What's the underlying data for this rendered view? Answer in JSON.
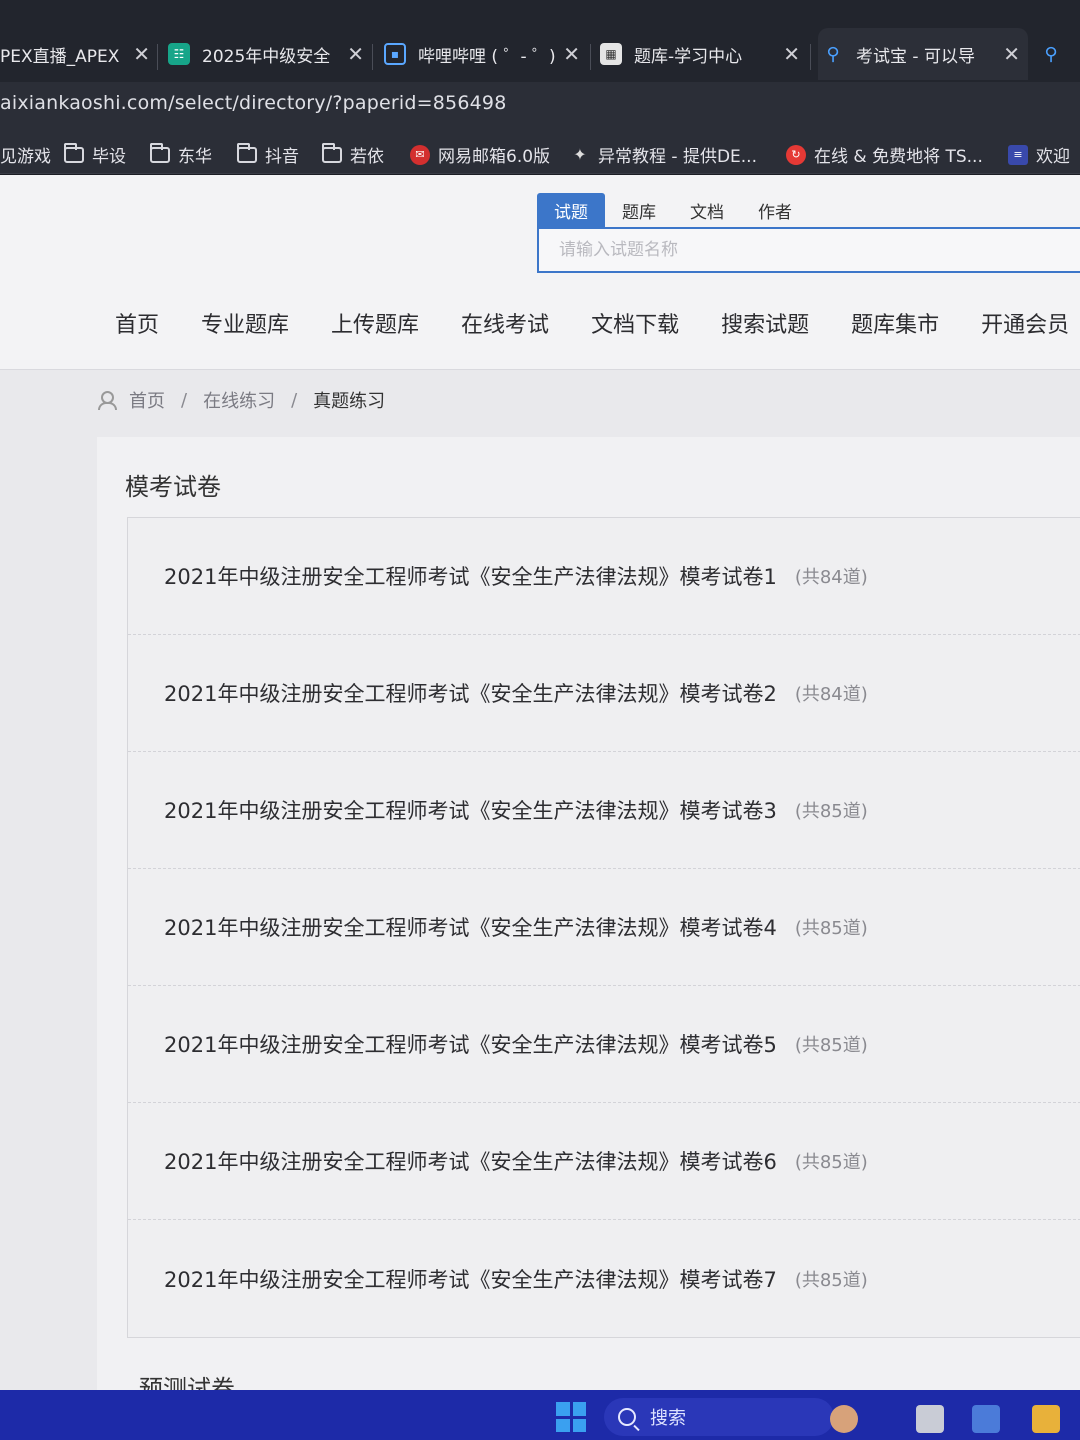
{
  "browser": {
    "tabs": [
      {
        "title": "PEX直播_APEX",
        "favicon_color": "#e44"
      },
      {
        "title": "2025年中级安全",
        "favicon_color": "#17a589"
      },
      {
        "title": "哔哩哔哩 ( ゜- ゜)",
        "favicon_color": "#1e90ff"
      },
      {
        "title": "题库-学习中心",
        "favicon_color": "#777"
      },
      {
        "title": "考试宝 - 可以导",
        "favicon_color": "#3c76c9"
      }
    ],
    "url": "aixiankaoshi.com/select/directory/?paperid=856498",
    "bookmarks": [
      {
        "label": "见游戏",
        "icon": "none"
      },
      {
        "label": "毕设",
        "icon": "folder-icon"
      },
      {
        "label": "东华",
        "icon": "folder-icon"
      },
      {
        "label": "抖音",
        "icon": "folder-icon"
      },
      {
        "label": "若依",
        "icon": "folder-icon"
      },
      {
        "label": "网易邮箱6.0版",
        "icon": "netease-mail-icon"
      },
      {
        "label": "异常教程 - 提供DE...",
        "icon": "exception-icon"
      },
      {
        "label": "在线 & 免费地将 TS...",
        "icon": "converter-icon"
      },
      {
        "label": "欢迎",
        "icon": "welcome-icon"
      }
    ]
  },
  "site": {
    "search_tabs": [
      "试题",
      "题库",
      "文档",
      "作者"
    ],
    "search_placeholder": "请输入试题名称",
    "nav": [
      "首页",
      "专业题库",
      "上传题库",
      "在线考试",
      "文档下载",
      "搜索试题",
      "题库集市",
      "开通会员"
    ],
    "breadcrumb": {
      "home": "首页",
      "middle": "在线练习",
      "current": "真题练习",
      "separator": "/"
    }
  },
  "main": {
    "section_title": "模考试卷",
    "papers": [
      {
        "title": "2021年中级注册安全工程师考试《安全生产法律法规》模考试卷1",
        "count": "(共84道)"
      },
      {
        "title": "2021年中级注册安全工程师考试《安全生产法律法规》模考试卷2",
        "count": "(共84道)"
      },
      {
        "title": "2021年中级注册安全工程师考试《安全生产法律法规》模考试卷3",
        "count": "(共85道)"
      },
      {
        "title": "2021年中级注册安全工程师考试《安全生产法律法规》模考试卷4",
        "count": "(共85道)"
      },
      {
        "title": "2021年中级注册安全工程师考试《安全生产法律法规》模考试卷5",
        "count": "(共85道)"
      },
      {
        "title": "2021年中级注册安全工程师考试《安全生产法律法规》模考试卷6",
        "count": "(共85道)"
      },
      {
        "title": "2021年中级注册安全工程师考试《安全生产法律法规》模考试卷7",
        "count": "(共85道)"
      }
    ],
    "next_section_title": "预测试卷"
  },
  "taskbar": {
    "search_label": "搜索",
    "accent": "#1d2aa8"
  }
}
